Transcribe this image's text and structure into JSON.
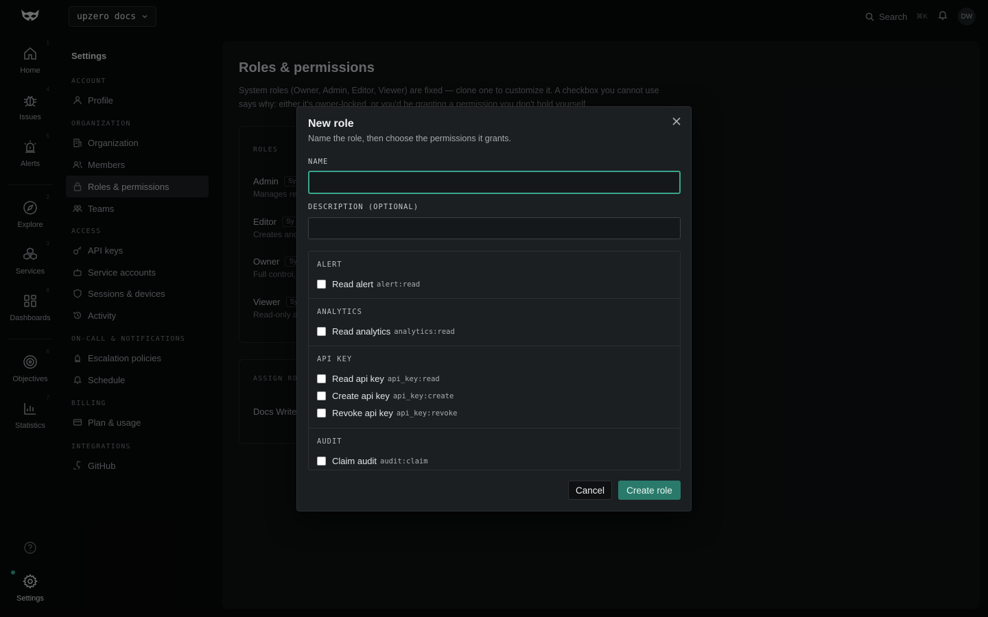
{
  "app": {
    "workspace": "upzero docs",
    "search_label": "Search",
    "search_shortcut": "⌘K",
    "user_initials": "DW"
  },
  "rail": {
    "items": [
      {
        "label": "Home",
        "kbd": "1",
        "icon": "home-icon"
      },
      {
        "label": "Issues",
        "kbd": "4",
        "icon": "bug-icon"
      },
      {
        "label": "Alerts",
        "kbd": "5",
        "icon": "siren-icon"
      },
      {
        "label": "Explore",
        "kbd": "2",
        "icon": "compass-icon"
      },
      {
        "label": "Services",
        "kbd": "3",
        "icon": "cubes-icon"
      },
      {
        "label": "Dashboards",
        "kbd": "8",
        "icon": "grid-icon"
      },
      {
        "label": "Objectives",
        "kbd": "6",
        "icon": "target-icon"
      },
      {
        "label": "Statistics",
        "kbd": "7",
        "icon": "bar-chart-icon"
      }
    ],
    "settings_label": "Settings",
    "accent": "#2e9e87"
  },
  "settings_nav": {
    "title": "Settings",
    "sections": [
      {
        "title": "ACCOUNT",
        "items": [
          "Profile"
        ]
      },
      {
        "title": "ORGANIZATION",
        "items": [
          "Organization",
          "Members",
          "Roles & permissions",
          "Teams"
        ]
      },
      {
        "title": "ACCESS",
        "items": [
          "API keys",
          "Service accounts",
          "Sessions & devices",
          "Activity"
        ]
      },
      {
        "title": "ON-CALL & NOTIFICATIONS",
        "items": [
          "Escalation policies",
          "Schedule"
        ]
      },
      {
        "title": "BILLING",
        "items": [
          "Plan & usage"
        ]
      },
      {
        "title": "INTEGRATIONS",
        "items": [
          "GitHub"
        ]
      }
    ],
    "active_item": "Roles & permissions"
  },
  "page": {
    "title": "Roles & permissions",
    "description": "System roles (Owner, Admin, Editor, Viewer) are fixed — clone one to customize it. A checkbox you cannot use says why: either it's owner-locked, or you'd be granting a permission you don't hold yourself.",
    "roles_label": "ROLES",
    "roles": [
      {
        "name": "Admin",
        "badge": "Sy",
        "sub": "Manages re"
      },
      {
        "name": "Editor",
        "badge": "Sy",
        "sub": "Creates and"
      },
      {
        "name": "Owner",
        "badge": "Sy",
        "sub": "Full control,"
      },
      {
        "name": "Viewer",
        "badge": "Sy",
        "sub": "Read-only a"
      }
    ],
    "assign_label": "ASSIGN RO",
    "assign_row": "Docs Write"
  },
  "modal": {
    "title": "New role",
    "subtitle": "Name the role, then choose the permissions it grants.",
    "name_label": "NAME",
    "name_value": "",
    "description_label": "DESCRIPTION (OPTIONAL)",
    "description_value": "",
    "groups": [
      {
        "title": "ALERT",
        "perms": [
          {
            "label": "Read alert",
            "code": "alert:read",
            "checked": false
          }
        ]
      },
      {
        "title": "ANALYTICS",
        "perms": [
          {
            "label": "Read analytics",
            "code": "analytics:read",
            "checked": false
          }
        ]
      },
      {
        "title": "API KEY",
        "perms": [
          {
            "label": "Read api key",
            "code": "api_key:read",
            "checked": false
          },
          {
            "label": "Create api key",
            "code": "api_key:create",
            "checked": false
          },
          {
            "label": "Revoke api key",
            "code": "api_key:revoke",
            "checked": false
          }
        ]
      },
      {
        "title": "AUDIT",
        "perms": [
          {
            "label": "Claim audit",
            "code": "audit:claim",
            "checked": false
          }
        ]
      }
    ],
    "cancel_label": "Cancel",
    "create_label": "Create role",
    "accent": "#2a7a6b"
  }
}
